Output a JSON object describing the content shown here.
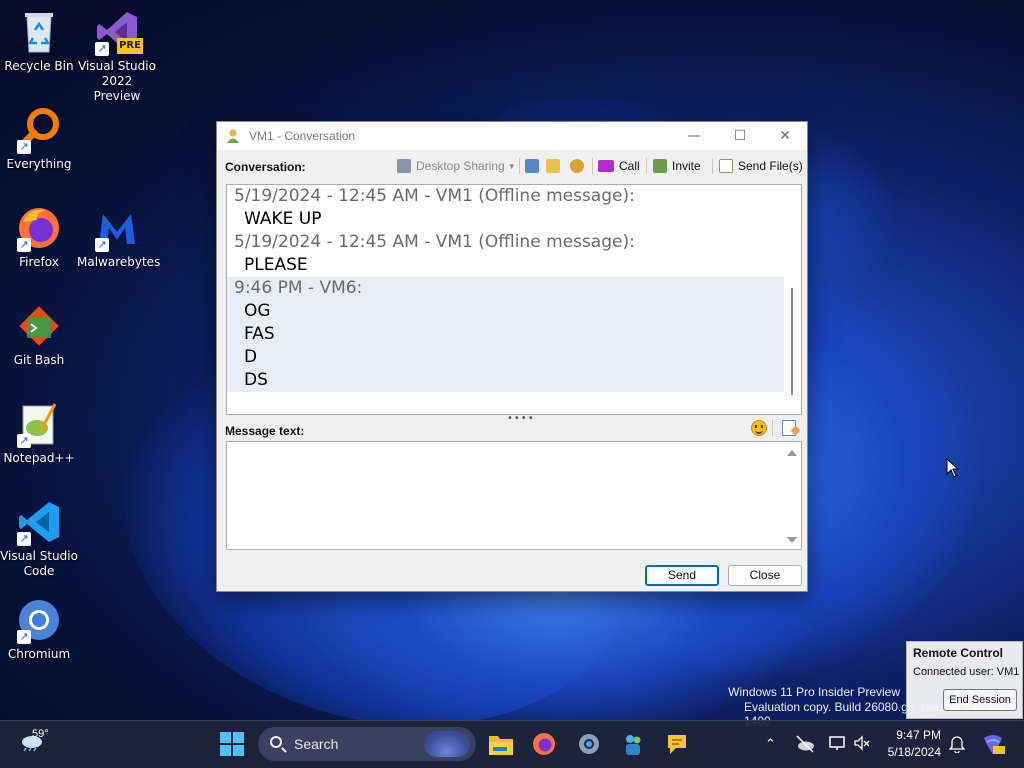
{
  "desktop": {
    "icons": [
      {
        "label": "Recycle Bin",
        "icon": "recycle-bin-icon"
      },
      {
        "label": "Visual Studio 2022 Preview",
        "icon": "visual-studio-preview-icon",
        "badge": "PRE"
      },
      {
        "label": "Everything",
        "icon": "everything-search-icon"
      },
      {
        "label": "Firefox",
        "icon": "firefox-icon"
      },
      {
        "label": "Malwarebytes",
        "icon": "malwarebytes-icon"
      },
      {
        "label": "Git Bash",
        "icon": "git-bash-icon"
      },
      {
        "label": "Notepad++",
        "icon": "notepad-plus-plus-icon"
      },
      {
        "label": "Visual Studio Code",
        "icon": "vscode-icon"
      },
      {
        "label": "Chromium",
        "icon": "chromium-icon"
      }
    ]
  },
  "window": {
    "title": "VM1 - Conversation",
    "minimize": "—",
    "maximize": "☐",
    "close": "✕",
    "toolbar": {
      "conversation_label": "Conversation:",
      "desktop_sharing": "Desktop Sharing",
      "call": "Call",
      "invite": "Invite",
      "send_files": "Send File(s)"
    },
    "messages": [
      {
        "header": "5/19/2024 - 12:45 AM - VM1 (Offline message):",
        "lines": [
          "WAKE UP"
        ],
        "highlight": false
      },
      {
        "header": "5/19/2024 - 12:45 AM - VM1 (Offline message):",
        "lines": [
          "PLEASE"
        ],
        "highlight": false
      },
      {
        "header": "9:46 PM - VM6:",
        "lines": [
          "OG",
          "FAS",
          "D",
          "DS"
        ],
        "highlight": true
      }
    ],
    "splitter_glyph": "••••",
    "message_text_label": "Message text:",
    "message_text_value": "",
    "send_label": "Send",
    "close_label": "Close"
  },
  "remote_control": {
    "title": "Remote Control",
    "connected_user": "Connected user: VM1",
    "end_session": "End Session"
  },
  "watermark": {
    "line1": "Windows 11 Pro Insider Preview",
    "line2": "Evaluation copy. Build 26080.ge_release.240308-1400"
  },
  "taskbar": {
    "weather_temp": "59°",
    "search_placeholder": "Search",
    "time": "9:47 PM",
    "date": "5/18/2024"
  },
  "colors": {
    "accent": "#0067c0",
    "highlight_row": "#e8eef8",
    "wallpaper_dark": "#071239",
    "wallpaper_bright": "#2a63d9"
  }
}
